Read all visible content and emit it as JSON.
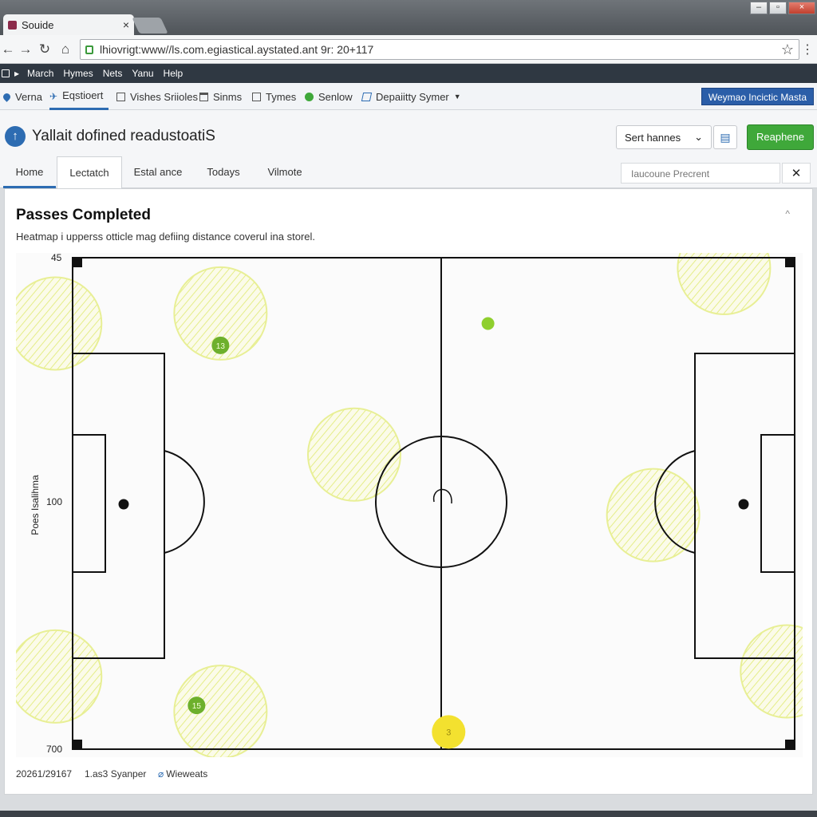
{
  "browser": {
    "tab_title": "Souide",
    "tab_close": "×",
    "url": "lhiovrigt:www//ls.com.egiastical.aystated.ant 9r: 20+117",
    "window_buttons": [
      "–",
      "▫",
      "×"
    ]
  },
  "bookmarks": [
    "March",
    "Hymes",
    "Nets",
    "Yanu",
    "Help"
  ],
  "toolbar": {
    "items": [
      {
        "label": "Verna",
        "icon": "pin-icon"
      },
      {
        "label": "Eqstioert",
        "icon": "plane-icon"
      },
      {
        "label": "Vishes Sriioles",
        "icon": "doc-icon"
      },
      {
        "label": "Sinms",
        "icon": "edit-icon"
      },
      {
        "label": "Tymes",
        "icon": "doc-icon"
      },
      {
        "label": "Senlow",
        "icon": "status-dot-icon"
      },
      {
        "label": "Depaiitty Symer",
        "icon": "edit-icon"
      }
    ],
    "cta": "Weymao Incictic Masta"
  },
  "page": {
    "title": "Yallait dofined readustoatiS",
    "sort_select": "Sert hannes",
    "primary_button": "Reaphene",
    "tabs": [
      "Home",
      "Lectatch",
      "Estal ance",
      "Todays",
      "Vilmote"
    ],
    "search_placeholder": "Iaucoune Precrent"
  },
  "card": {
    "title": "Passes Completed",
    "subtitle": "Heatmap i upperss otticle mag defiing distance coverul ina storel.",
    "collapse_icon": "^",
    "footer_date": "20261/29167",
    "footer_user": "1.as3 Syanper",
    "footer_link": "Wieweats"
  },
  "chart_data": {
    "type": "heatmap",
    "title": "Passes Completed",
    "ylabel": "Poes Isalihma",
    "y_ticks": [
      "45",
      "100",
      "700"
    ],
    "zones": [
      {
        "x": 0.05,
        "y": 0.14,
        "value": "",
        "marker": false
      },
      {
        "x": 0.26,
        "y": 0.12,
        "value": "13",
        "marker": true
      },
      {
        "x": 0.43,
        "y": 0.4,
        "value": "",
        "marker": false
      },
      {
        "x": 0.05,
        "y": 0.84,
        "value": "",
        "marker": false
      },
      {
        "x": 0.26,
        "y": 0.91,
        "value": "15",
        "marker": true
      },
      {
        "x": 0.9,
        "y": 0.03,
        "value": "",
        "marker": false
      },
      {
        "x": 0.81,
        "y": 0.52,
        "value": "",
        "marker": false
      },
      {
        "x": 0.98,
        "y": 0.83,
        "value": "",
        "marker": false
      }
    ],
    "markers": [
      {
        "x": 0.6,
        "y": 0.14,
        "value": "",
        "color": "#8fcf2e"
      },
      {
        "x": 0.55,
        "y": 0.95,
        "value": "3",
        "color": "#f3e12f"
      }
    ],
    "colors": {
      "zone": "#e6ee8a",
      "marker": "#6db02c",
      "line": "#111111"
    }
  }
}
